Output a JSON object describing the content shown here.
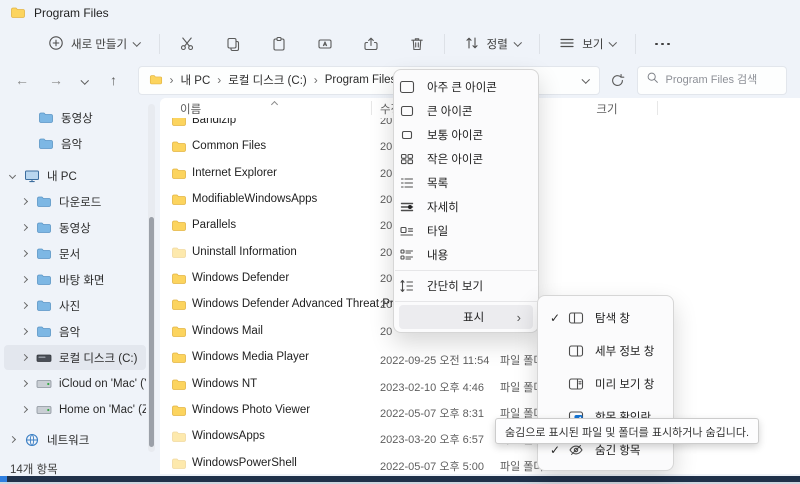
{
  "window": {
    "title": "Program Files"
  },
  "toolbar": {
    "new_label": "새로 만들기",
    "sort_label": "정렬",
    "view_label": "보기",
    "icons": [
      "circle-plus",
      "cut",
      "copy",
      "paste",
      "rename",
      "share",
      "delete",
      "sort-arrows",
      "view-lines",
      "more-dots"
    ]
  },
  "address": {
    "breadcrumbs": [
      "내 PC",
      "로컬 디스크 (C:)",
      "Program Files"
    ]
  },
  "search": {
    "placeholder": "Program Files 검색"
  },
  "sidebar": {
    "items": [
      {
        "key": "videos-quick",
        "label": "동영상",
        "icon": "folder",
        "depth": 2
      },
      {
        "key": "music-quick",
        "label": "음악",
        "icon": "folder",
        "depth": 2
      },
      {
        "key": "this-pc",
        "label": "내 PC",
        "icon": "pc",
        "depth": 0,
        "expanded": true
      },
      {
        "key": "downloads",
        "label": "다운로드",
        "icon": "folder",
        "depth": 1,
        "chevron": true
      },
      {
        "key": "videos",
        "label": "동영상",
        "icon": "folder",
        "depth": 1,
        "chevron": true
      },
      {
        "key": "documents",
        "label": "문서",
        "icon": "folder",
        "depth": 1,
        "chevron": true
      },
      {
        "key": "desktop",
        "label": "바탕 화면",
        "icon": "folder",
        "depth": 1,
        "chevron": true
      },
      {
        "key": "pictures",
        "label": "사진",
        "icon": "folder",
        "depth": 1,
        "chevron": true
      },
      {
        "key": "music",
        "label": "음악",
        "icon": "folder",
        "depth": 1,
        "chevron": true
      },
      {
        "key": "local-disk-c",
        "label": "로컬 디스크 (C:)",
        "icon": "disk",
        "depth": 1,
        "chevron": true,
        "selected": true
      },
      {
        "key": "icloud-mac-y",
        "label": "iCloud on 'Mac' (Y:)",
        "icon": "drive",
        "depth": 1,
        "chevron": true
      },
      {
        "key": "home-mac-z",
        "label": "Home on 'Mac' (Z:)",
        "icon": "drive",
        "depth": 1,
        "chevron": true
      },
      {
        "key": "network",
        "label": "네트워크",
        "icon": "network",
        "depth": 0,
        "chevron": true
      }
    ]
  },
  "list": {
    "columns": {
      "name": "이름",
      "modified": "수정한 날짜",
      "size": "크기"
    },
    "rows": [
      {
        "name": "Bandizip",
        "modified": "20",
        "type": ""
      },
      {
        "name": "Common Files",
        "modified": "20",
        "type": ""
      },
      {
        "name": "Internet Explorer",
        "modified": "20",
        "type": ""
      },
      {
        "name": "ModifiableWindowsApps",
        "modified": "20",
        "type": ""
      },
      {
        "name": "Parallels",
        "modified": "20",
        "type": ""
      },
      {
        "name": "Uninstall Information",
        "modified": "20",
        "type": "",
        "dim": true
      },
      {
        "name": "Windows Defender",
        "modified": "20",
        "type": ""
      },
      {
        "name": "Windows Defender Advanced Threat Pr...",
        "modified": "20",
        "type": ""
      },
      {
        "name": "Windows Mail",
        "modified": "20",
        "type": ""
      },
      {
        "name": "Windows Media Player",
        "modified": "2022-09-25 오전 11:54",
        "type": "파일 폴더"
      },
      {
        "name": "Windows NT",
        "modified": "2023-02-10 오후 4:46",
        "type": "파일 폴더"
      },
      {
        "name": "Windows Photo Viewer",
        "modified": "2022-05-07 오후 8:31",
        "type": "파일 폴더"
      },
      {
        "name": "WindowsApps",
        "modified": "2023-03-20 오후 6:57",
        "type": "파일 폴더",
        "dim": true
      },
      {
        "name": "WindowsPowerShell",
        "modified": "2022-05-07 오후 5:00",
        "type": "파일 폴더",
        "dim": true
      }
    ]
  },
  "view_menu": {
    "items": [
      {
        "key": "extra-large-icons",
        "label": "아주 큰 아이콘",
        "icon": "xl-icons"
      },
      {
        "key": "large-icons",
        "label": "큰 아이콘",
        "icon": "l-icons"
      },
      {
        "key": "medium-icons",
        "label": "보통 아이콘",
        "icon": "m-icons"
      },
      {
        "key": "small-icons",
        "label": "작은 아이콘",
        "icon": "s-icons"
      },
      {
        "key": "list",
        "label": "목록",
        "icon": "list-lines"
      },
      {
        "key": "details",
        "label": "자세히",
        "icon": "details-lines",
        "selected": true
      },
      {
        "key": "tiles",
        "label": "타일",
        "icon": "tiles"
      },
      {
        "key": "content",
        "label": "내용",
        "icon": "content-lines"
      },
      {
        "key": "sep-1",
        "separator": true
      },
      {
        "key": "compact-view",
        "label": "간단히 보기",
        "icon": "compact"
      },
      {
        "key": "sep-2",
        "separator": true
      },
      {
        "key": "show",
        "label": "표시",
        "submenu": true,
        "highlighted": true
      }
    ]
  },
  "show_submenu": {
    "items": [
      {
        "key": "navigation-pane",
        "label": "탐색 창",
        "icon": "nav-pane",
        "checked": true
      },
      {
        "key": "details-pane",
        "label": "세부 정보 창",
        "icon": "info-pane"
      },
      {
        "key": "preview-pane",
        "label": "미리 보기 창",
        "icon": "preview-pane"
      },
      {
        "key": "item-checkboxes",
        "label": "항목 확인란",
        "icon": "checkboxes"
      },
      {
        "key": "hidden-items",
        "label": "숨긴 항목",
        "icon": "hidden-eye",
        "checked": true
      }
    ]
  },
  "tooltip": {
    "text": "숨김으로 표시된 파일 및 폴더를 표시하거나 숨깁니다."
  },
  "status": {
    "text": "14개 항목"
  },
  "colors": {
    "accent": "#1574d4",
    "window_bg": "#eff3f9",
    "menu_bg": "#fbfbfc",
    "folder_yellow": "#fcd45e",
    "highlight": "#ececef"
  }
}
